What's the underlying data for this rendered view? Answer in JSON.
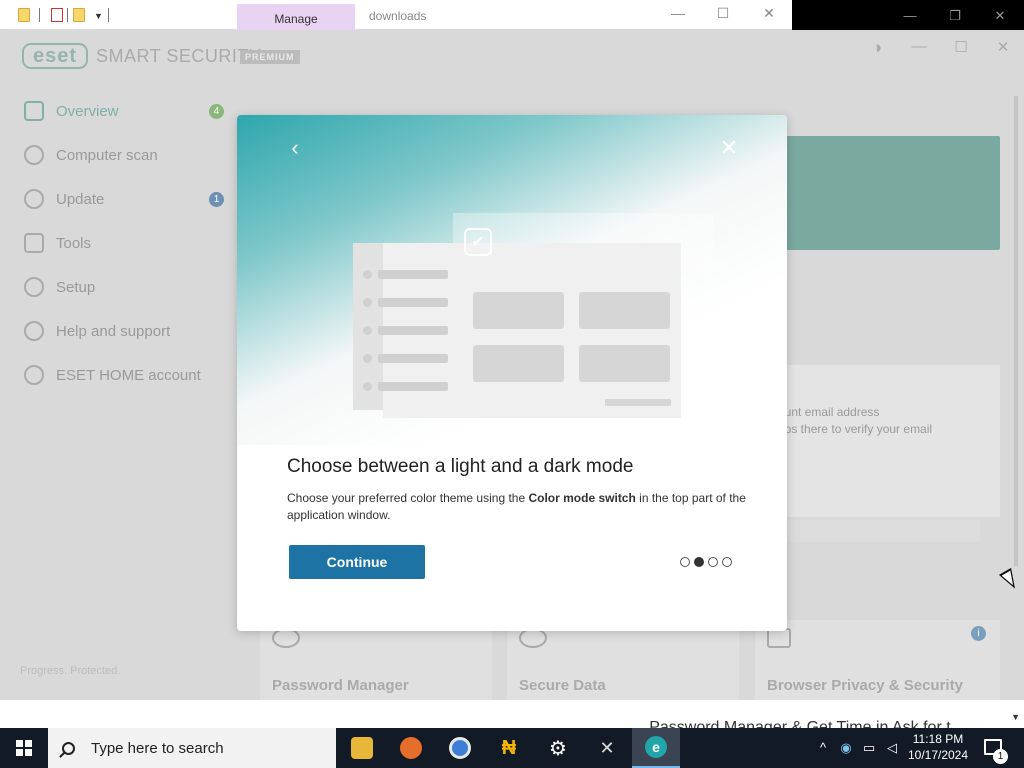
{
  "explorer": {
    "manage_tab": "Manage",
    "window_title": "downloads"
  },
  "eset": {
    "logo": "eset",
    "brand": "SMART SECURITY",
    "brand_badge": "PREMIUM",
    "nav": [
      {
        "label": "Overview",
        "badge": "4"
      },
      {
        "label": "Computer scan"
      },
      {
        "label": "Update",
        "badge": "1"
      },
      {
        "label": "Tools"
      },
      {
        "label": "Setup"
      },
      {
        "label": "Help and support"
      },
      {
        "label": "ESET HOME account"
      }
    ],
    "footer": "Progress. Protected.",
    "info_card": {
      "line1": "ount email address",
      "line2": "eps there to verify your email"
    },
    "tiles": [
      {
        "label": "Password Manager"
      },
      {
        "label": "Secure Data"
      },
      {
        "label": "Browser Privacy & Security",
        "info": "i"
      }
    ]
  },
  "bottom_strip_text": "Password Manager & Get Time in Ask for t...",
  "modal": {
    "back_icon": "‹",
    "close_icon": "✕",
    "title": "Choose between a light and a dark mode",
    "desc_before": "Choose your preferred color theme using the ",
    "desc_bold": "Color mode switch",
    "desc_after": " in the top part of the application window.",
    "continue_label": "Continue",
    "steps_total": 4,
    "current_step": 2
  },
  "taskbar": {
    "search_placeholder": "Type here to search",
    "time": "11:18 PM",
    "date": "10/17/2024",
    "notifications": "1"
  },
  "colors": {
    "accent": "#1d74a4",
    "hero_teal": "#2ea7ad",
    "taskbar": "#111a25"
  }
}
